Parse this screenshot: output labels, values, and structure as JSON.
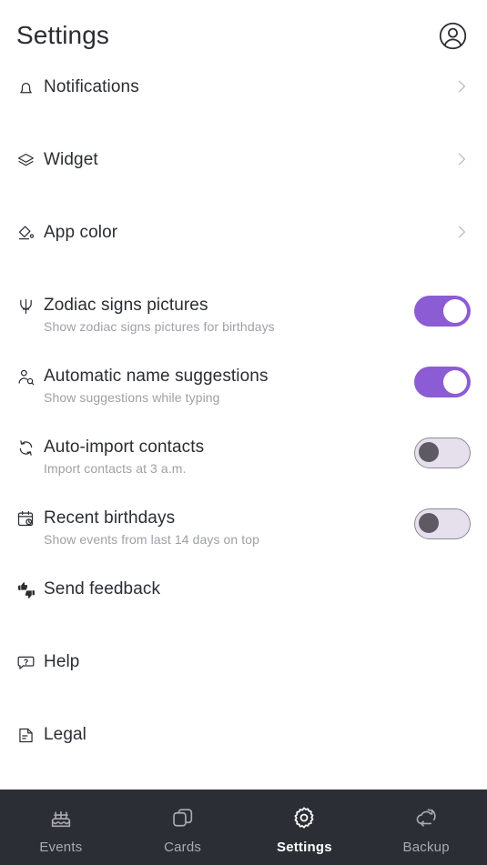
{
  "header": {
    "title": "Settings",
    "avatar_icon": "account-circle-icon"
  },
  "settings_rows": [
    {
      "id": "notifications",
      "icon": "bell-icon",
      "title": "Notifications",
      "subtitle": "",
      "trailing": "chevron-right"
    },
    {
      "id": "widget",
      "icon": "layers-icon",
      "title": "Widget",
      "subtitle": "",
      "trailing": "chevron-right"
    },
    {
      "id": "app-color",
      "icon": "paint-bucket-icon",
      "title": "App color",
      "subtitle": "",
      "trailing": "chevron-right"
    },
    {
      "id": "zodiac-signs-pictures",
      "icon": "trident-icon",
      "title": "Zodiac signs pictures",
      "subtitle": "Show zodiac signs pictures for birthdays",
      "trailing": "toggle",
      "toggle_state": "on"
    },
    {
      "id": "automatic-name-suggestions",
      "icon": "person-search-icon",
      "title": "Automatic name suggestions",
      "subtitle": "Show suggestions while typing",
      "trailing": "toggle",
      "toggle_state": "on"
    },
    {
      "id": "auto-import-contacts",
      "icon": "refresh-icon",
      "title": "Auto-import contacts",
      "subtitle": "Import contacts at 3 a.m.",
      "trailing": "toggle",
      "toggle_state": "off"
    },
    {
      "id": "recent-birthdays",
      "icon": "calendar-clock-icon",
      "title": "Recent birthdays",
      "subtitle": "Show events from last 14 days on top",
      "trailing": "toggle",
      "toggle_state": "off"
    },
    {
      "id": "send-feedback",
      "icon": "thumbs-up-down-icon",
      "title": "Send feedback",
      "subtitle": "",
      "trailing": "none"
    },
    {
      "id": "help",
      "icon": "help-bubble-icon",
      "title": "Help",
      "subtitle": "",
      "trailing": "none"
    },
    {
      "id": "legal",
      "icon": "document-icon",
      "title": "Legal",
      "subtitle": "",
      "trailing": "none"
    }
  ],
  "bottom_nav": {
    "active": "Settings",
    "items": [
      {
        "id": "events",
        "label": "Events",
        "icon": "cake-icon"
      },
      {
        "id": "cards",
        "label": "Cards",
        "icon": "cards-icon"
      },
      {
        "id": "settings",
        "label": "Settings",
        "icon": "gear-icon"
      },
      {
        "id": "backup",
        "label": "Backup",
        "icon": "cloud-sync-icon"
      }
    ]
  },
  "colors": {
    "toggle_on": "#8c5cd4",
    "toggle_off_track": "#e6dfec",
    "toggle_off_knob": "#5e5a64",
    "nav_background": "#2b2e34",
    "text_primary": "#2b2d33",
    "text_secondary": "#9fa0a6"
  }
}
